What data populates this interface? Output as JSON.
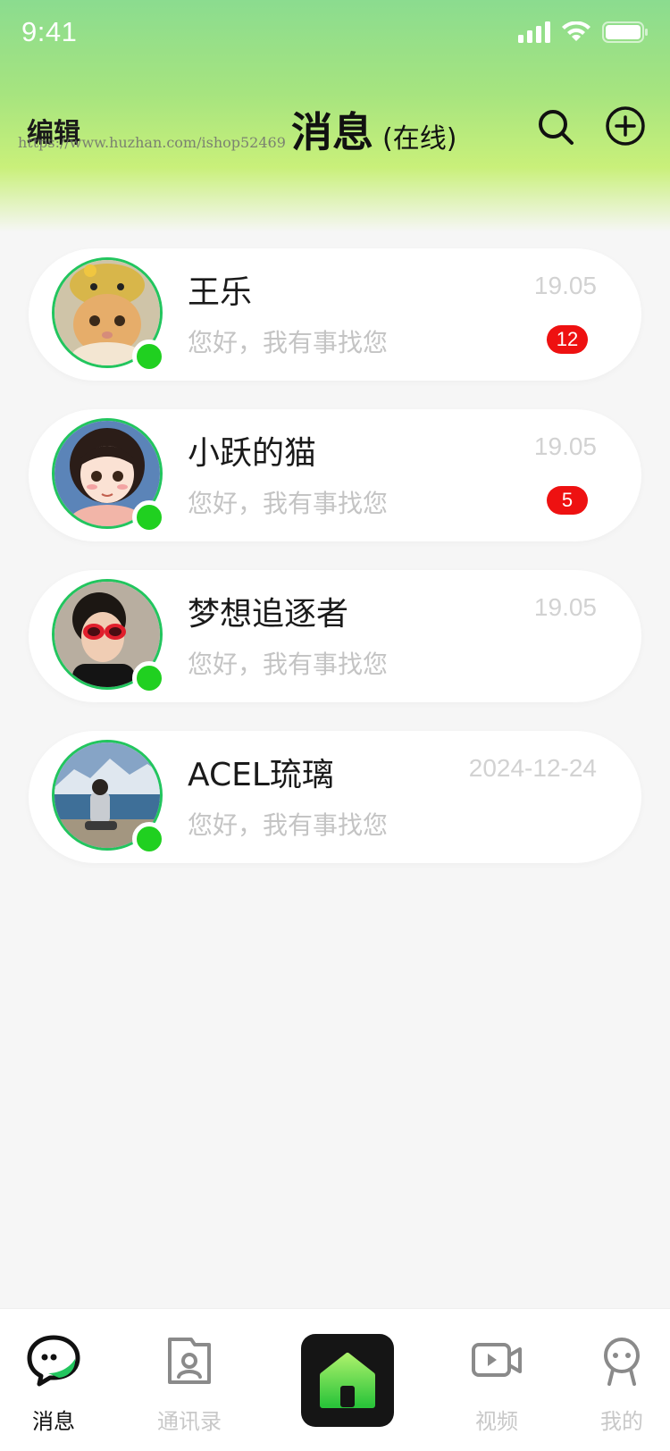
{
  "status_bar": {
    "time": "9:41",
    "icons": [
      "signal-icon",
      "wifi-icon",
      "battery-icon"
    ]
  },
  "header": {
    "edit_label": "编辑",
    "watermark": "https://www.huzhan.com/ishop52469",
    "title": "消息",
    "subtitle": "(在线)",
    "icons": [
      "search-icon",
      "add-circle-icon"
    ]
  },
  "chats": [
    {
      "name": "王乐",
      "time": "19.05",
      "preview": "您好，我有事找您",
      "unread": "12",
      "online": true
    },
    {
      "name": "小跃的猫",
      "time": "19.05",
      "preview": "您好，我有事找您",
      "unread": "5",
      "online": true
    },
    {
      "name": "梦想追逐者",
      "time": "19.05",
      "preview": "您好，我有事找您",
      "unread": "",
      "online": true
    },
    {
      "name": "ACEL琉璃",
      "time": "2024-12-24",
      "preview": "您好，我有事找您",
      "unread": "",
      "online": true
    }
  ],
  "tab_bar": {
    "tabs": [
      {
        "label": "消息",
        "icon": "chat-bubble-icon",
        "active": true
      },
      {
        "label": "通讯录",
        "icon": "contacts-icon",
        "active": false
      },
      {
        "label": "",
        "icon": "home-icon",
        "active": false
      },
      {
        "label": "视频",
        "icon": "video-icon",
        "active": false
      },
      {
        "label": "我的",
        "icon": "profile-icon",
        "active": false
      }
    ]
  },
  "colors": {
    "accent_green": "#22c55e",
    "online_dot": "#20d020",
    "badge_red": "#ee1111",
    "header_gradient_top": "#8bdc8f",
    "header_gradient_bottom": "#c9f07a"
  }
}
